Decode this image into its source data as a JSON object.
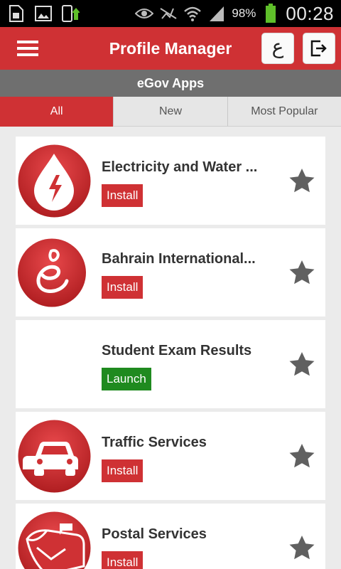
{
  "status_bar": {
    "battery": "98%",
    "time": "00:28",
    "icons": [
      "sim-card-icon",
      "image-icon",
      "download-phone-icon",
      "eye-icon",
      "no-signal-icon",
      "wifi-icon",
      "cell-signal-icon",
      "battery-icon"
    ]
  },
  "app_bar": {
    "title": "Profile Manager",
    "language_button": "ع",
    "menu_icon": "hamburger-menu-icon",
    "logout_icon": "logout-icon"
  },
  "section": {
    "title": "eGov Apps"
  },
  "tabs": [
    {
      "label": "All",
      "active": true
    },
    {
      "label": "New",
      "active": false
    },
    {
      "label": "Most Popular",
      "active": false
    }
  ],
  "apps": [
    {
      "name": "Electricity and Water ...",
      "button": "Install",
      "icon": "electricity-water-icon"
    },
    {
      "name": "Bahrain International...",
      "button": "Install",
      "icon": "bahrain-international-icon"
    },
    {
      "name": "Student Exam Results",
      "button": "Launch",
      "icon": ""
    },
    {
      "name": "Traffic Services",
      "button": "Install",
      "icon": "car-icon"
    },
    {
      "name": "Postal Services",
      "button": "Install",
      "icon": "mailbox-icon"
    }
  ],
  "colors": {
    "primary_red": "#cf3134",
    "launch_green": "#1f8a1f",
    "section_gray": "#6f6f6f",
    "star_gray": "#606060"
  }
}
